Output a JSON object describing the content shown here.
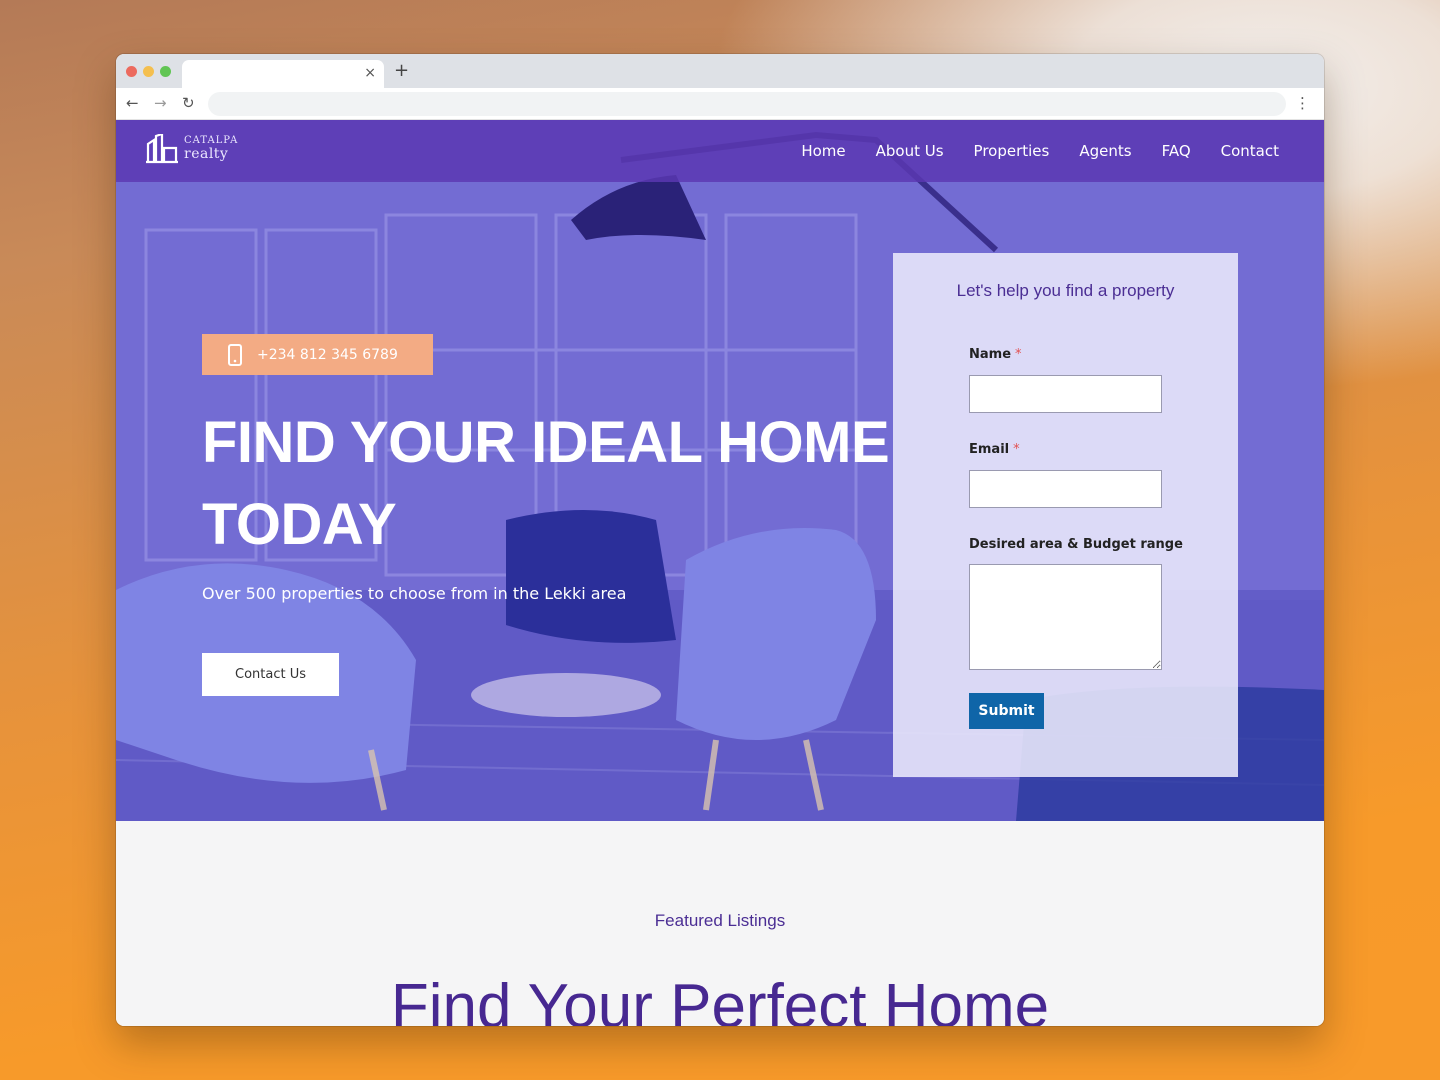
{
  "browser": {
    "tab_title": "",
    "tab_close": "×",
    "new_tab": "+",
    "back": "←",
    "forward": "→",
    "reload": "↻",
    "url": "",
    "menu": "⋮"
  },
  "logo": {
    "line1": "CATALPA",
    "line2": "realty"
  },
  "nav": {
    "items": [
      "Home",
      "About Us",
      "Properties",
      "Agents",
      "FAQ",
      "Contact"
    ]
  },
  "hero": {
    "phone": "+234 812 345 6789",
    "title_line1": "FIND YOUR IDEAL HOME",
    "title_line2": "TODAY",
    "subtitle": "Over 500 properties to choose from in the Lekki area",
    "contact_button": "Contact Us"
  },
  "form": {
    "title": "Let's help you find a property",
    "name_label": "Name",
    "email_label": "Email",
    "area_label": "Desired area & Budget range",
    "required_mark": "*",
    "name_value": "",
    "email_value": "",
    "area_value": "",
    "submit_label": "Submit"
  },
  "featured": {
    "label": "Featured Listings",
    "heading": "Find Your Perfect Home"
  },
  "colors": {
    "hero_overlay": "#6a5fc9",
    "nav_bar": "#5c38b2",
    "phone_badge": "#f3ab84",
    "brand_purple": "#4b2e94",
    "submit": "#0f65a8"
  }
}
